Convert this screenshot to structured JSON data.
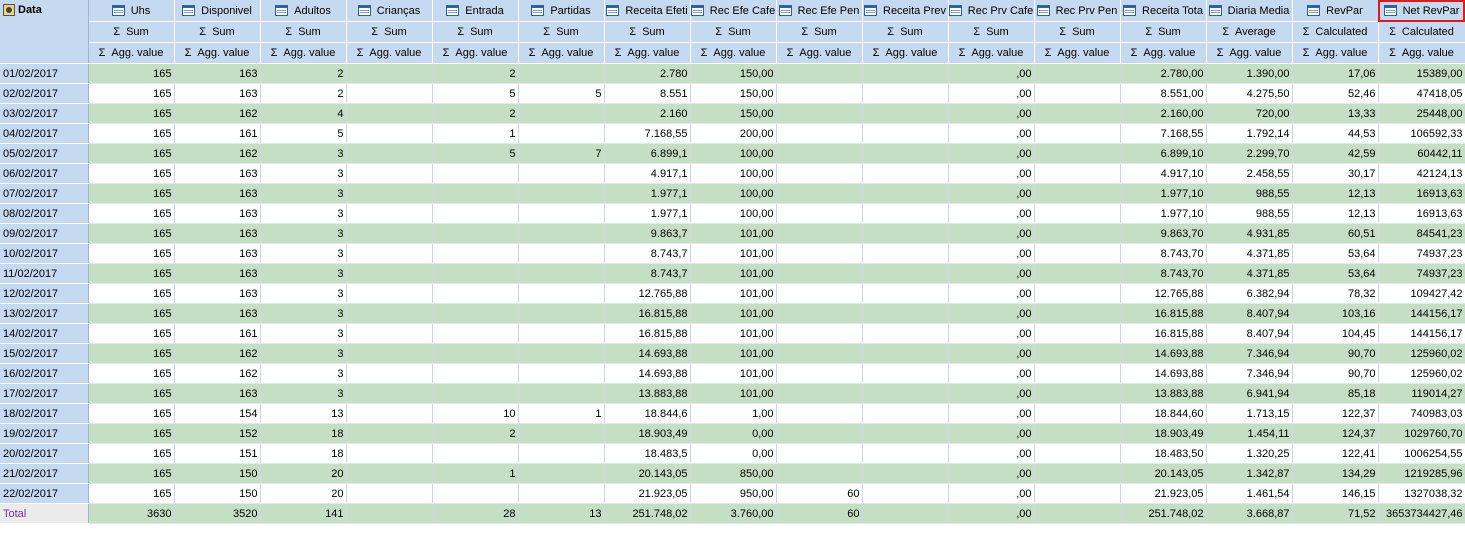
{
  "corner_label": "Data",
  "columns": [
    {
      "label": "Uhs",
      "agg": "Sum",
      "sub": "Agg. value"
    },
    {
      "label": "Disponivel",
      "agg": "Sum",
      "sub": "Agg. value"
    },
    {
      "label": "Adultos",
      "agg": "Sum",
      "sub": "Agg. value"
    },
    {
      "label": "Crianças",
      "agg": "Sum",
      "sub": "Agg. value"
    },
    {
      "label": "Entrada",
      "agg": "Sum",
      "sub": "Agg. value"
    },
    {
      "label": "Partidas",
      "agg": "Sum",
      "sub": "Agg. value"
    },
    {
      "label": "Receita Efeti",
      "agg": "Sum",
      "sub": "Agg. value"
    },
    {
      "label": "Rec Efe Cafe",
      "agg": "Sum",
      "sub": "Agg. value"
    },
    {
      "label": "Rec Efe Pen",
      "agg": "Sum",
      "sub": "Agg. value"
    },
    {
      "label": "Receita Prev",
      "agg": "Sum",
      "sub": "Agg. value"
    },
    {
      "label": "Rec Prv Cafe",
      "agg": "Sum",
      "sub": "Agg. value"
    },
    {
      "label": "Rec Prv Pen",
      "agg": "Sum",
      "sub": "Agg. value"
    },
    {
      "label": "Receita Tota",
      "agg": "Sum",
      "sub": "Agg. value"
    },
    {
      "label": "Diaria Media",
      "agg": "Average",
      "sub": "Agg. value"
    },
    {
      "label": "RevPar",
      "agg": "Calculated",
      "sub": "Agg. value"
    },
    {
      "label": "Net RevPar",
      "agg": "Calculated",
      "sub": "Agg. value"
    }
  ],
  "rows": [
    {
      "date": "01/02/2017",
      "values": [
        "165",
        "163",
        "2",
        "",
        "2",
        "",
        "2.780",
        "150,00",
        "",
        "",
        ",00",
        "",
        "2.780,00",
        "1.390,00",
        "17,06",
        "15389,00"
      ]
    },
    {
      "date": "02/02/2017",
      "values": [
        "165",
        "163",
        "2",
        "",
        "5",
        "5",
        "8.551",
        "150,00",
        "",
        "",
        ",00",
        "",
        "8.551,00",
        "4.275,50",
        "52,46",
        "47418,05"
      ]
    },
    {
      "date": "03/02/2017",
      "values": [
        "165",
        "162",
        "4",
        "",
        "2",
        "",
        "2.160",
        "150,00",
        "",
        "",
        ",00",
        "",
        "2.160,00",
        "720,00",
        "13,33",
        "25448,00"
      ]
    },
    {
      "date": "04/02/2017",
      "values": [
        "165",
        "161",
        "5",
        "",
        "1",
        "",
        "7.168,55",
        "200,00",
        "",
        "",
        ",00",
        "",
        "7.168,55",
        "1.792,14",
        "44,53",
        "106592,33"
      ]
    },
    {
      "date": "05/02/2017",
      "values": [
        "165",
        "162",
        "3",
        "",
        "5",
        "7",
        "6.899,1",
        "100,00",
        "",
        "",
        ",00",
        "",
        "6.899,10",
        "2.299,70",
        "42,59",
        "60442,11"
      ]
    },
    {
      "date": "06/02/2017",
      "values": [
        "165",
        "163",
        "3",
        "",
        "",
        "",
        "4.917,1",
        "100,00",
        "",
        "",
        ",00",
        "",
        "4.917,10",
        "2.458,55",
        "30,17",
        "42124,13"
      ]
    },
    {
      "date": "07/02/2017",
      "values": [
        "165",
        "163",
        "3",
        "",
        "",
        "",
        "1.977,1",
        "100,00",
        "",
        "",
        ",00",
        "",
        "1.977,10",
        "988,55",
        "12,13",
        "16913,63"
      ]
    },
    {
      "date": "08/02/2017",
      "values": [
        "165",
        "163",
        "3",
        "",
        "",
        "",
        "1.977,1",
        "100,00",
        "",
        "",
        ",00",
        "",
        "1.977,10",
        "988,55",
        "12,13",
        "16913,63"
      ]
    },
    {
      "date": "09/02/2017",
      "values": [
        "165",
        "163",
        "3",
        "",
        "",
        "",
        "9.863,7",
        "101,00",
        "",
        "",
        ",00",
        "",
        "9.863,70",
        "4.931,85",
        "60,51",
        "84541,23"
      ]
    },
    {
      "date": "10/02/2017",
      "values": [
        "165",
        "163",
        "3",
        "",
        "",
        "",
        "8.743,7",
        "101,00",
        "",
        "",
        ",00",
        "",
        "8.743,70",
        "4.371,85",
        "53,64",
        "74937,23"
      ]
    },
    {
      "date": "11/02/2017",
      "values": [
        "165",
        "163",
        "3",
        "",
        "",
        "",
        "8.743,7",
        "101,00",
        "",
        "",
        ",00",
        "",
        "8.743,70",
        "4.371,85",
        "53,64",
        "74937,23"
      ]
    },
    {
      "date": "12/02/2017",
      "values": [
        "165",
        "163",
        "3",
        "",
        "",
        "",
        "12.765,88",
        "101,00",
        "",
        "",
        ",00",
        "",
        "12.765,88",
        "6.382,94",
        "78,32",
        "109427,42"
      ]
    },
    {
      "date": "13/02/2017",
      "values": [
        "165",
        "163",
        "3",
        "",
        "",
        "",
        "16.815,88",
        "101,00",
        "",
        "",
        ",00",
        "",
        "16.815,88",
        "8.407,94",
        "103,16",
        "144156,17"
      ]
    },
    {
      "date": "14/02/2017",
      "values": [
        "165",
        "161",
        "3",
        "",
        "",
        "",
        "16.815,88",
        "101,00",
        "",
        "",
        ",00",
        "",
        "16.815,88",
        "8.407,94",
        "104,45",
        "144156,17"
      ]
    },
    {
      "date": "15/02/2017",
      "values": [
        "165",
        "162",
        "3",
        "",
        "",
        "",
        "14.693,88",
        "101,00",
        "",
        "",
        ",00",
        "",
        "14.693,88",
        "7.346,94",
        "90,70",
        "125960,02"
      ]
    },
    {
      "date": "16/02/2017",
      "values": [
        "165",
        "162",
        "3",
        "",
        "",
        "",
        "14.693,88",
        "101,00",
        "",
        "",
        ",00",
        "",
        "14.693,88",
        "7.346,94",
        "90,70",
        "125960,02"
      ]
    },
    {
      "date": "17/02/2017",
      "values": [
        "165",
        "163",
        "3",
        "",
        "",
        "",
        "13.883,88",
        "101,00",
        "",
        "",
        ",00",
        "",
        "13.883,88",
        "6.941,94",
        "85,18",
        "119014,27"
      ]
    },
    {
      "date": "18/02/2017",
      "values": [
        "165",
        "154",
        "13",
        "",
        "10",
        "1",
        "18.844,6",
        "1,00",
        "",
        "",
        ",00",
        "",
        "18.844,60",
        "1.713,15",
        "122,37",
        "740983,03"
      ]
    },
    {
      "date": "19/02/2017",
      "values": [
        "165",
        "152",
        "18",
        "",
        "2",
        "",
        "18.903,49",
        "0,00",
        "",
        "",
        ",00",
        "",
        "18.903,49",
        "1.454,11",
        "124,37",
        "1029760,70"
      ]
    },
    {
      "date": "20/02/2017",
      "values": [
        "165",
        "151",
        "18",
        "",
        "",
        "",
        "18.483,5",
        "0,00",
        "",
        "",
        ",00",
        "",
        "18.483,50",
        "1.320,25",
        "122,41",
        "1006254,55"
      ]
    },
    {
      "date": "21/02/2017",
      "values": [
        "165",
        "150",
        "20",
        "",
        "1",
        "",
        "20.143,05",
        "850,00",
        "",
        "",
        ",00",
        "",
        "20.143,05",
        "1.342,87",
        "134,29",
        "1219285,96"
      ]
    },
    {
      "date": "22/02/2017",
      "values": [
        "165",
        "150",
        "20",
        "",
        "",
        "",
        "21.923,05",
        "950,00",
        "60",
        "",
        ",00",
        "",
        "21.923,05",
        "1.461,54",
        "146,15",
        "1327038,32"
      ]
    }
  ],
  "total": {
    "label": "Total",
    "values": [
      "3630",
      "3520",
      "141",
      "",
      "28",
      "13",
      "251.748,02",
      "3.760,00",
      "60",
      "",
      ",00",
      "",
      "251.748,02",
      "3.668,87",
      "71,52",
      "3653734427,46"
    ]
  },
  "colors": {
    "header_bg": "#c5d9f1",
    "row_alt_bg": "#c4dfc4",
    "selected_outline": "#e0191b",
    "total_label": "#7030a0"
  },
  "selected_column": "Net RevPar"
}
